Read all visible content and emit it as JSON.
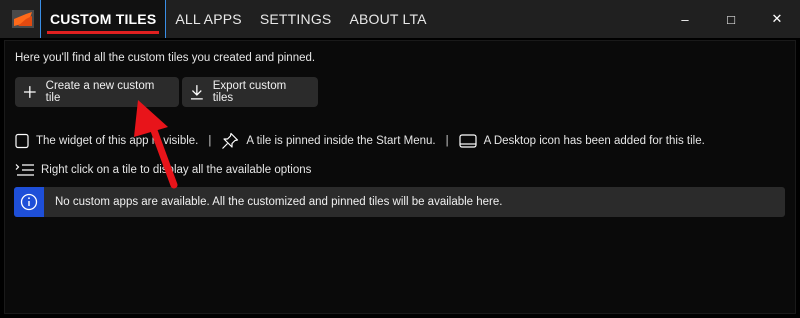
{
  "tabs": [
    {
      "label": "CUSTOM TILES",
      "active": true
    },
    {
      "label": "ALL APPS",
      "active": false
    },
    {
      "label": "SETTINGS",
      "active": false
    },
    {
      "label": "ABOUT LTA",
      "active": false
    }
  ],
  "window_controls": {
    "minimize": "–",
    "maximize": "□",
    "close": "✕"
  },
  "main": {
    "intro": "Here you'll find all the custom tiles you created and pinned.",
    "create_button": "Create a new custom tile",
    "export_button": "Export custom tiles",
    "legend": {
      "widget": "The widget of this app is visible.",
      "separator": "|",
      "pinned": "A tile is pinned inside the Start Menu.",
      "desktop": "A Desktop icon has been added for this tile."
    },
    "hint": "Right click on a tile to display all the available options",
    "info_message": "No custom apps are available. All the customized and pinned tiles will be available here."
  },
  "icons": [
    "app-logo-icon",
    "plus-icon",
    "download-icon",
    "widget-icon",
    "pin-icon",
    "desktop-icon",
    "context-menu-icon",
    "info-icon"
  ],
  "colors": {
    "accent_tab_underline": "#e02020",
    "info_icon_bg": "#1e4fd8",
    "annotation_arrow": "#e8141a",
    "button_bg": "#2b2b2b"
  }
}
